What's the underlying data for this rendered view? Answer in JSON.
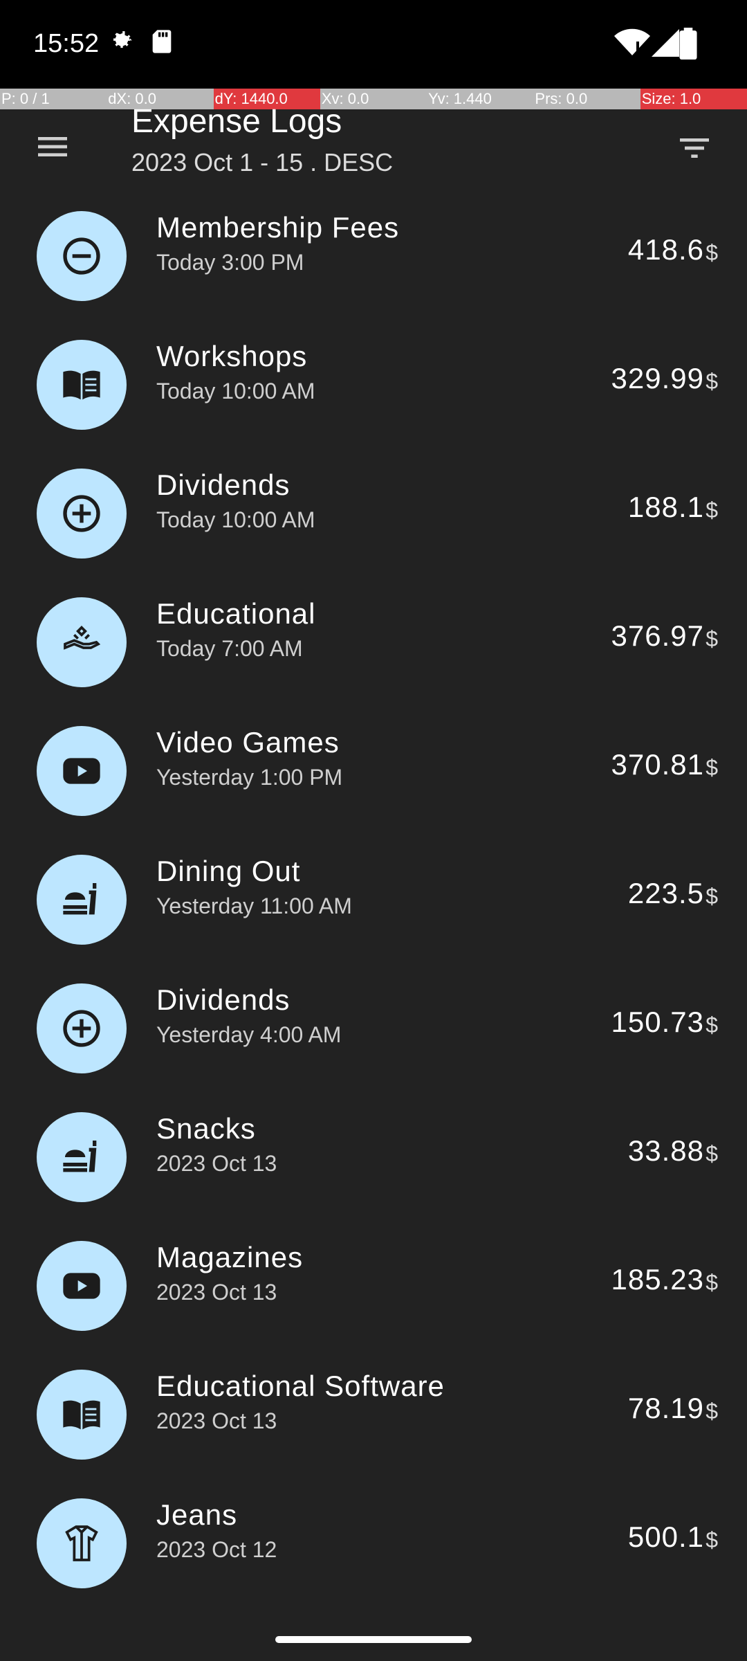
{
  "status_bar": {
    "time": "15:52"
  },
  "debug_bar": {
    "p": "P: 0 / 1",
    "dx": "dX: 0.0",
    "dy": "dY: 1440.0",
    "xv": "Xv: 0.0",
    "yv": "Yv: 1.440",
    "prs": "Prs: 0.0",
    "size": "Size: 1.0"
  },
  "header": {
    "title": "Expense Logs",
    "subtitle": "2023 Oct 1 - 15 . DESC"
  },
  "colors": {
    "avatar_bg": "#bde6ff",
    "background": "#222222"
  },
  "expenses": [
    {
      "name": "Membership Fees",
      "time": "Today 3:00 PM",
      "amount": "418.6",
      "currency": "$",
      "icon": "remove-circle-icon"
    },
    {
      "name": "Workshops",
      "time": "Today 10:00 AM",
      "amount": "329.99",
      "currency": "$",
      "icon": "book-icon"
    },
    {
      "name": "Dividends",
      "time": "Today 10:00 AM",
      "amount": "188.1",
      "currency": "$",
      "icon": "add-circle-icon"
    },
    {
      "name": "Educational",
      "time": "Today 7:00 AM",
      "amount": "376.97",
      "currency": "$",
      "icon": "hand-donation-icon"
    },
    {
      "name": "Video Games",
      "time": "Yesterday 1:00 PM",
      "amount": "370.81",
      "currency": "$",
      "icon": "video-play-icon"
    },
    {
      "name": "Dining Out",
      "time": "Yesterday 11:00 AM",
      "amount": "223.5",
      "currency": "$",
      "icon": "fastfood-icon"
    },
    {
      "name": "Dividends",
      "time": "Yesterday 4:00 AM",
      "amount": "150.73",
      "currency": "$",
      "icon": "add-circle-icon"
    },
    {
      "name": "Snacks",
      "time": "2023 Oct 13",
      "amount": "33.88",
      "currency": "$",
      "icon": "fastfood-icon"
    },
    {
      "name": "Magazines",
      "time": "2023 Oct 13",
      "amount": "185.23",
      "currency": "$",
      "icon": "video-play-icon"
    },
    {
      "name": "Educational Software",
      "time": "2023 Oct 13",
      "amount": "78.19",
      "currency": "$",
      "icon": "book-icon"
    },
    {
      "name": "Jeans",
      "time": "2023 Oct 12",
      "amount": "500.1",
      "currency": "$",
      "icon": "shirt-icon"
    }
  ]
}
